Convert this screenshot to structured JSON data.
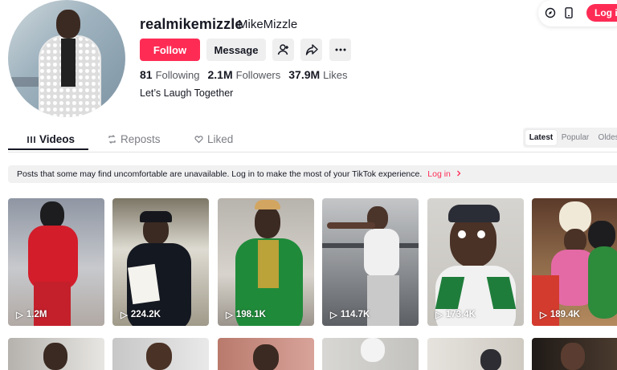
{
  "profile": {
    "username": "realmikemizzle",
    "nickname": "MikeMizzle",
    "follow_label": "Follow",
    "message_label": "Message",
    "following_count": "81",
    "following_label": "Following",
    "followers_count": "2.1M",
    "followers_label": "Followers",
    "likes_count": "37.9M",
    "likes_label": "Likes",
    "bio": "Let’s Laugh Together"
  },
  "topbar": {
    "login_label": "Log in"
  },
  "tabs": [
    {
      "label": "Videos"
    },
    {
      "label": "Reposts"
    },
    {
      "label": "Liked"
    }
  ],
  "sort": {
    "options": [
      "Latest",
      "Popular",
      "Oldest"
    ],
    "selected": "Latest"
  },
  "notice": {
    "text": "Posts that some may find uncomfortable are unavailable. Log in to make the most of your TikTok experience.",
    "link": "Log in"
  },
  "videos": [
    {
      "views": "1.2M"
    },
    {
      "views": "224.2K"
    },
    {
      "views": "198.1K"
    },
    {
      "views": "114.7K"
    },
    {
      "views": "173.4K"
    },
    {
      "views": "189.4K"
    }
  ],
  "icons": [
    "add-friend-icon",
    "share-icon",
    "more-icon",
    "compass-icon",
    "phone-icon",
    "grid-icon",
    "repost-icon",
    "liked-icon",
    "play-icon",
    "chevron-right-icon"
  ],
  "colors": {
    "brand": "#fe2c55",
    "text": "#161823",
    "muted": "#7c7e85"
  }
}
